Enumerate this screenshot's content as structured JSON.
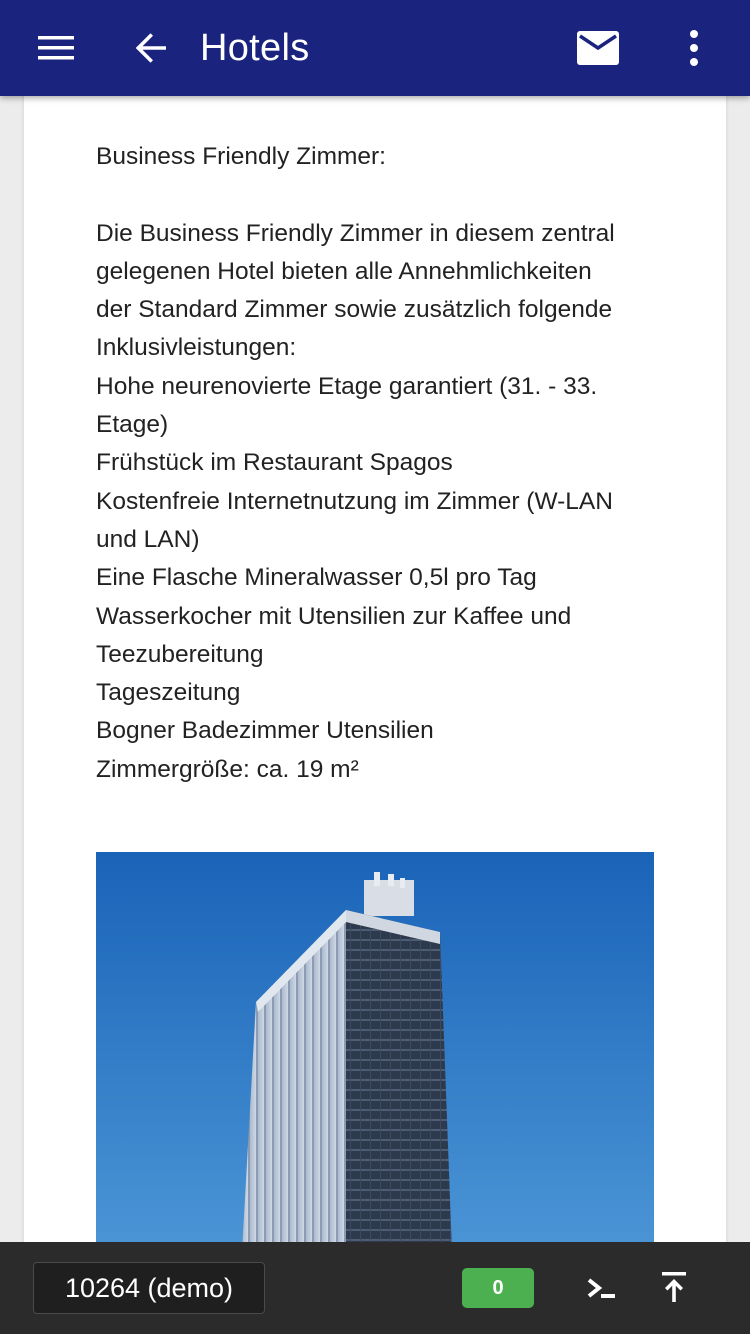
{
  "header": {
    "title": "Hotels",
    "icons": [
      "menu-icon",
      "back-arrow-icon",
      "mail-icon",
      "more-vert-icon"
    ],
    "background_color": "#1a237e"
  },
  "content": {
    "heading": "Business Friendly Zimmer:",
    "lines": [
      "Die Business Friendly Zimmer in diesem zentral",
      "gelegenen Hotel bieten alle Annehmlichkeiten",
      "der Standard Zimmer sowie zusätzlich folgende",
      "Inklusivleistungen:",
      "Hohe neurenovierte Etage garantiert (31. - 33.",
      "Etage)",
      "Frühstück im Restaurant Spagos",
      "Kostenfreie Internetnutzung im Zimmer (W-LAN",
      "und LAN)",
      "Eine Flasche Mineralwasser 0,5l pro Tag",
      "Wasserkocher mit Utensilien zur Kaffee und",
      "Teezubereitung",
      "Tageszeitung",
      "Bogner Badezimmer Utensilien",
      "Zimmergröße: ca. 19 m²"
    ]
  },
  "footer": {
    "device_label": "10264 (demo)",
    "badge_count": "0",
    "badge_color": "#4caf50",
    "icons": [
      "terminal-icon",
      "scroll-top-icon"
    ]
  }
}
